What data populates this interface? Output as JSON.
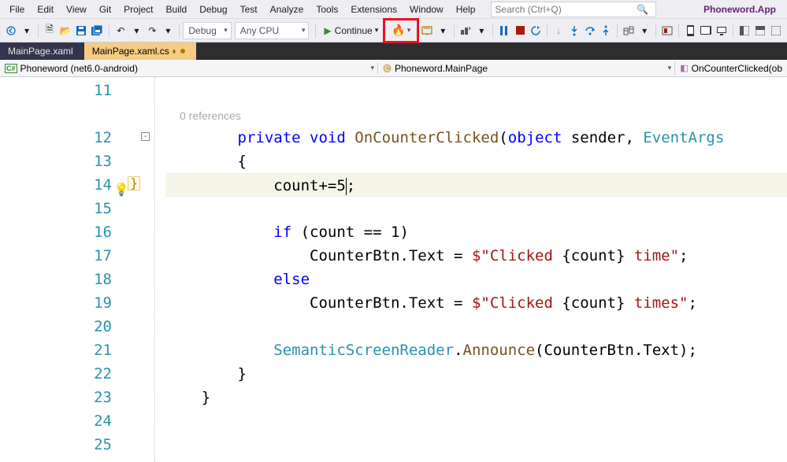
{
  "menu": [
    "File",
    "Edit",
    "View",
    "Git",
    "Project",
    "Build",
    "Debug",
    "Test",
    "Analyze",
    "Tools",
    "Extensions",
    "Window",
    "Help"
  ],
  "search": {
    "placeholder": "Search (Ctrl+Q)"
  },
  "appname": "Phoneword.App",
  "combos": {
    "config": "Debug",
    "platform": "Any CPU"
  },
  "run_label": "Continue",
  "tabs": [
    {
      "label": "MainPage.xaml",
      "active": false
    },
    {
      "label": "MainPage.xaml.cs",
      "active": true,
      "dirty": true,
      "pinned": true
    }
  ],
  "nav": {
    "left": "Phoneword (net6.0-android)",
    "mid": "Phoneword.MainPage",
    "right": "OnCounterClicked(ob"
  },
  "editor": {
    "first_line_no": 11,
    "references_label": "0 references",
    "lines": [
      {
        "n": 11,
        "t": ""
      },
      {
        "n": 12,
        "t": "CODE",
        "tokens": [
          [
            "        ",
            ""
          ],
          [
            "private",
            "kw"
          ],
          [
            " ",
            ""
          ],
          [
            "void",
            "kw"
          ],
          [
            " ",
            ""
          ],
          [
            "OnCounterClicked",
            "mth"
          ],
          [
            "(",
            ""
          ],
          [
            "object",
            "kw"
          ],
          [
            " sender, ",
            ""
          ],
          [
            "EventArgs",
            "ty"
          ]
        ]
      },
      {
        "n": 13,
        "t": "CODE",
        "tokens": [
          [
            "        {",
            ""
          ]
        ]
      },
      {
        "n": 14,
        "t": "CODE",
        "hl": true,
        "tokens": [
          [
            "            count+=5",
            ""
          ],
          [
            "CARET",
            ""
          ],
          [
            ";",
            ""
          ]
        ]
      },
      {
        "n": 15,
        "t": ""
      },
      {
        "n": 16,
        "t": "CODE",
        "tokens": [
          [
            "            ",
            ""
          ],
          [
            "if",
            "kw"
          ],
          [
            " (count == 1)",
            ""
          ]
        ]
      },
      {
        "n": 17,
        "t": "CODE",
        "tokens": [
          [
            "                CounterBtn.Text = ",
            ""
          ],
          [
            "$\"Clicked ",
            "str"
          ],
          [
            "{count}",
            ""
          ],
          [
            " time\"",
            "str"
          ],
          [
            ";",
            ""
          ]
        ]
      },
      {
        "n": 18,
        "t": "CODE",
        "tokens": [
          [
            "            ",
            ""
          ],
          [
            "else",
            "kw"
          ]
        ]
      },
      {
        "n": 19,
        "t": "CODE",
        "tokens": [
          [
            "                CounterBtn.Text = ",
            ""
          ],
          [
            "$\"Clicked ",
            "str"
          ],
          [
            "{count}",
            ""
          ],
          [
            " times\"",
            "str"
          ],
          [
            ";",
            ""
          ]
        ]
      },
      {
        "n": 20,
        "t": ""
      },
      {
        "n": 21,
        "t": "CODE",
        "tokens": [
          [
            "            ",
            ""
          ],
          [
            "SemanticScreenReader",
            "ty"
          ],
          [
            ".",
            ""
          ],
          [
            "Announce",
            "mth"
          ],
          [
            "(CounterBtn.Text);",
            ""
          ]
        ]
      },
      {
        "n": 22,
        "t": "CODE",
        "tokens": [
          [
            "        }",
            ""
          ]
        ]
      },
      {
        "n": 23,
        "t": "CODE",
        "tokens": [
          [
            "    }",
            ""
          ]
        ]
      },
      {
        "n": 24,
        "t": ""
      },
      {
        "n": 25,
        "t": ""
      }
    ]
  }
}
